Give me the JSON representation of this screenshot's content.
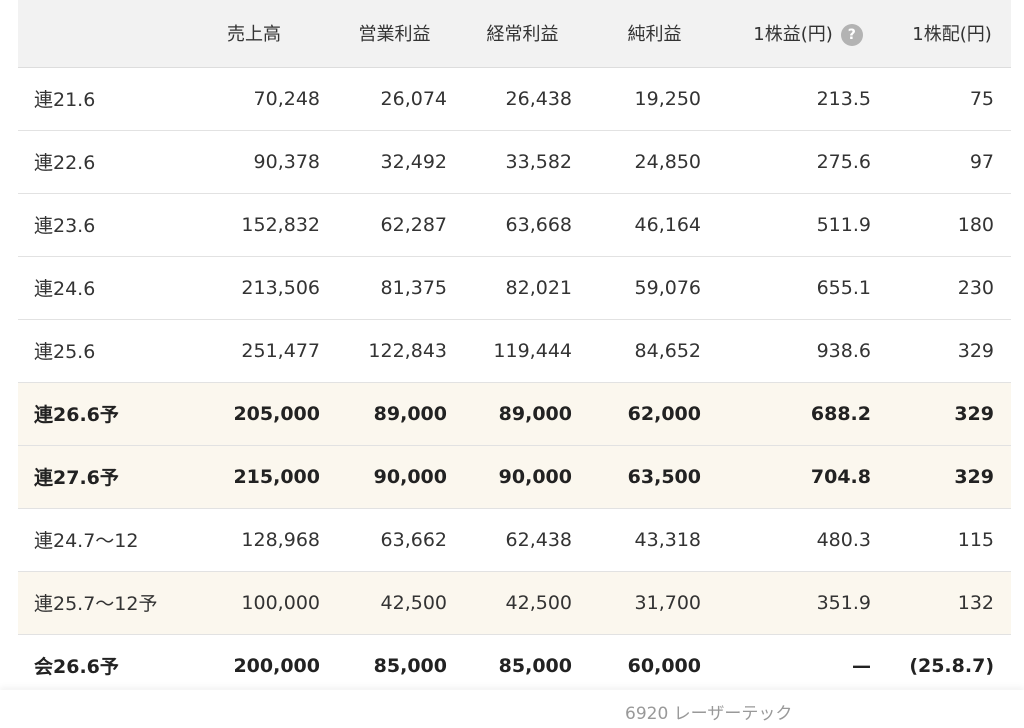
{
  "table": {
    "headers": {
      "period": "",
      "sales": "売上高",
      "operating_profit": "営業利益",
      "ordinary_profit": "経常利益",
      "net_profit": "純利益",
      "eps": "1株益(円)",
      "help_icon": "?",
      "dividend": "1株配(円)"
    },
    "rows": [
      {
        "period": "連21.6",
        "sales": "70,248",
        "operating_profit": "26,074",
        "ordinary_profit": "26,438",
        "net_profit": "19,250",
        "eps": "213.5",
        "dividend": "75"
      },
      {
        "period": "連22.6",
        "sales": "90,378",
        "operating_profit": "32,492",
        "ordinary_profit": "33,582",
        "net_profit": "24,850",
        "eps": "275.6",
        "dividend": "97"
      },
      {
        "period": "連23.6",
        "sales": "152,832",
        "operating_profit": "62,287",
        "ordinary_profit": "63,668",
        "net_profit": "46,164",
        "eps": "511.9",
        "dividend": "180"
      },
      {
        "period": "連24.6",
        "sales": "213,506",
        "operating_profit": "81,375",
        "ordinary_profit": "82,021",
        "net_profit": "59,076",
        "eps": "655.1",
        "dividend": "230"
      },
      {
        "period": "連25.6",
        "sales": "251,477",
        "operating_profit": "122,843",
        "ordinary_profit": "119,444",
        "net_profit": "84,652",
        "eps": "938.6",
        "dividend": "329"
      },
      {
        "period": "連26.6予",
        "sales": "205,000",
        "operating_profit": "89,000",
        "ordinary_profit": "89,000",
        "net_profit": "62,000",
        "eps": "688.2",
        "dividend": "329"
      },
      {
        "period": "連27.6予",
        "sales": "215,000",
        "operating_profit": "90,000",
        "ordinary_profit": "90,000",
        "net_profit": "63,500",
        "eps": "704.8",
        "dividend": "329"
      },
      {
        "period": "連24.7～12",
        "sales": "128,968",
        "operating_profit": "63,662",
        "ordinary_profit": "62,438",
        "net_profit": "43,318",
        "eps": "480.3",
        "dividend": "115"
      },
      {
        "period": "連25.7～12予",
        "sales": "100,000",
        "operating_profit": "42,500",
        "ordinary_profit": "42,500",
        "net_profit": "31,700",
        "eps": "351.9",
        "dividend": "132"
      },
      {
        "period": "会26.6予",
        "sales": "200,000",
        "operating_profit": "85,000",
        "ordinary_profit": "85,000",
        "net_profit": "60,000",
        "eps": "—",
        "dividend": "(25.8.7)"
      }
    ]
  },
  "footer": {
    "company": "6920 レーザーテック"
  },
  "colors": {
    "header_bg": "#f2f2f2",
    "forecast_row_bg": "#fbf7ee",
    "row_divider": "#e2e2e2",
    "text": "#333333",
    "help_icon_bg": "#b3b3b3",
    "footer_text": "#999999"
  }
}
